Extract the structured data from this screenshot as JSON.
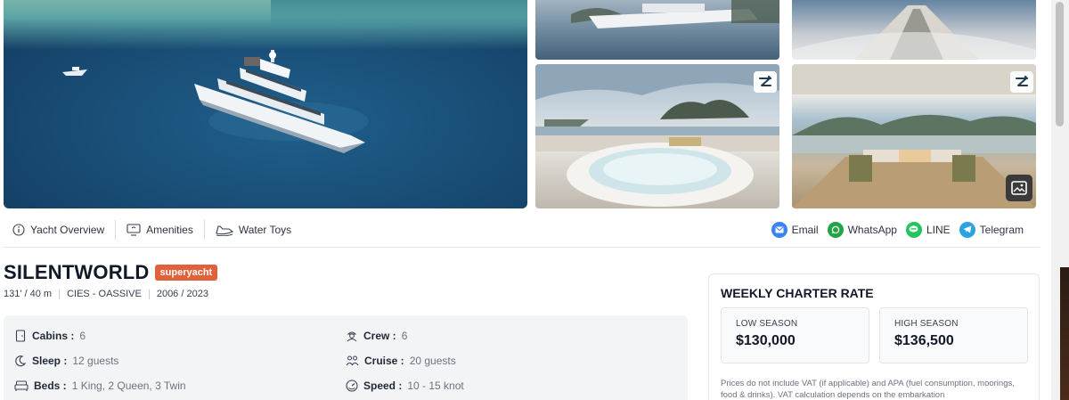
{
  "tabs": {
    "overview": "Yacht Overview",
    "amenities": "Amenities",
    "water_toys": "Water Toys"
  },
  "share": {
    "email": "Email",
    "whatsapp": "WhatsApp",
    "line": "LINE",
    "telegram": "Telegram"
  },
  "yacht": {
    "name": "SILENTWORLD",
    "type": "superyacht",
    "length": "131' / 40 m",
    "builder": "CIES - OASSIVE",
    "years": "2006 / 2023"
  },
  "specs": {
    "cabins_label": "Cabins :",
    "cabins_value": "6",
    "crew_label": "Crew :",
    "crew_value": "6",
    "sleep_label": "Sleep :",
    "sleep_value": "12 guests",
    "cruise_label": "Cruise :",
    "cruise_value": "20 guests",
    "beds_label": "Beds :",
    "beds_value": "1 King, 2 Queen, 3 Twin",
    "speed_label": "Speed :",
    "speed_value": "10 - 15 knot"
  },
  "rate": {
    "title": "WEEKLY CHARTER RATE",
    "low_label": "LOW SEASON",
    "low_price": "$130,000",
    "high_label": "HIGH SEASON",
    "high_price": "$136,500",
    "note": "Prices do not include VAT (if applicable) and APA (fuel consumption, moorings, food & drinks). VAT calculation depends on the embarkation"
  },
  "colors": {
    "badge": "#e0613b",
    "email": "#3b82f6",
    "whatsapp": "#22a447",
    "line": "#22c55e",
    "telegram": "#2aa3e0"
  }
}
